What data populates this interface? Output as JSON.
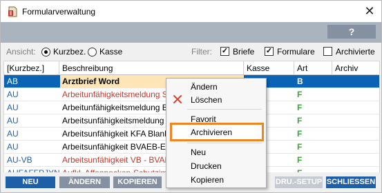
{
  "window": {
    "title": "Formularverwaltung",
    "close_glyph": "✕",
    "icon": "document-app-icon"
  },
  "toolbar": {
    "help_label": "?"
  },
  "filters": {
    "ansicht_label": "Ansicht:",
    "view_options": [
      {
        "label": "Kurzbez.",
        "selected": true
      },
      {
        "label": "Kasse",
        "selected": false
      }
    ],
    "filter_label": "Filter:",
    "checkboxes": [
      {
        "label": "Briefe",
        "checked": true
      },
      {
        "label": "Formulare",
        "checked": true
      },
      {
        "label": "Archivierte",
        "checked": false
      }
    ]
  },
  "table": {
    "columns": [
      "[Kurzbez.]",
      "Beschreibung",
      "Kasse",
      "Art",
      "Archiv"
    ],
    "rows": [
      {
        "kurz": "AB",
        "desc": "Arztbrief Word",
        "kasse": "",
        "art": "B",
        "archiv": "",
        "selected": true
      },
      {
        "kurz": "AU",
        "desc": "Arbeitunfähigkeitsmeldung SVS",
        "kasse": "",
        "art": "F",
        "archiv": ""
      },
      {
        "kurz": "AU",
        "desc": "Arbeitunfähigkeitsmeldung BVA",
        "kasse": "",
        "art": "F",
        "archiv": ""
      },
      {
        "kurz": "AU",
        "desc": "Arbeitsunfähigkeitsmeldung SVS",
        "kasse": "",
        "art": "F",
        "archiv": ""
      },
      {
        "kurz": "AU",
        "desc": "Arbeitsunfähigkeit KFA Blanko",
        "kasse": "",
        "art": "F",
        "archiv": ""
      },
      {
        "kurz": "AU",
        "desc": "Arbeitsunfähigkeit BVAEB-EB A",
        "kasse": "",
        "art": "F",
        "archiv": ""
      },
      {
        "kurz": "AU-VB",
        "desc": "Arbeitsunfähigkeit VB - BVAEB-C",
        "kasse": "",
        "art": "F",
        "archiv": ""
      },
      {
        "kurz": "AUFAFFPJYN",
        "desc": "Aufkl. Affenpocken-Schutzimpfu",
        "kasse": "",
        "art": "F",
        "archiv": ""
      }
    ],
    "colors": {
      "red_text": "#c0392b",
      "blue_text": "#1f5fb0",
      "green_art": "#3aa53a",
      "selected_bg": "#0a63b5"
    }
  },
  "footer": {
    "buttons": [
      {
        "label": "NEU"
      },
      {
        "label": "ÄNDERN"
      },
      {
        "label": "KOPIEREN"
      },
      {
        "label": "DRU.-SETUP"
      },
      {
        "label": "SCHLIESSEN"
      }
    ]
  },
  "context_menu": {
    "items": [
      "Ändern",
      "Löschen",
      "Favorit",
      "Archivieren",
      "Neu",
      "Drucken",
      "Kopieren"
    ],
    "highlighted": "Archivieren",
    "highlight_color": "#ee8522"
  }
}
